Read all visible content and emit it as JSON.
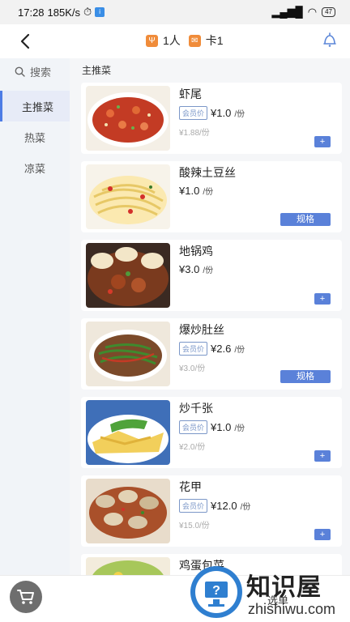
{
  "status": {
    "time": "17:28",
    "speed": "185K/s",
    "battery": "47"
  },
  "header": {
    "people": "1人",
    "table": "卡1"
  },
  "sidebar": {
    "search": "搜索",
    "items": [
      {
        "label": "主推菜"
      },
      {
        "label": "热菜"
      },
      {
        "label": "凉菜"
      }
    ]
  },
  "main": {
    "section_title": "主推菜",
    "dishes": [
      {
        "name": "虾尾",
        "member_tag": "会员价",
        "price": "¥1.0",
        "unit": "/份",
        "orig": "¥1.88/份",
        "action": "+"
      },
      {
        "name": "酸辣土豆丝",
        "price": "¥1.0",
        "unit": "/份",
        "action": "规格"
      },
      {
        "name": "地锅鸡",
        "price": "¥3.0",
        "unit": "/份",
        "action": "+"
      },
      {
        "name": "爆炒肚丝",
        "member_tag": "会员价",
        "price": "¥2.6",
        "unit": "/份",
        "orig": "¥3.0/份",
        "action": "规格"
      },
      {
        "name": "炒千张",
        "member_tag": "会员价",
        "price": "¥1.0",
        "unit": "/份",
        "orig": "¥2.0/份",
        "action": "+"
      },
      {
        "name": "花甲",
        "member_tag": "会员价",
        "price": "¥12.0",
        "unit": "/份",
        "orig": "¥15.0/份",
        "action": "+"
      },
      {
        "name": "鸡蛋包菜"
      }
    ]
  },
  "bottom": {
    "checkout": "选单"
  },
  "watermark": {
    "text": "知识屋",
    "sub": "zhishiwu.com"
  }
}
